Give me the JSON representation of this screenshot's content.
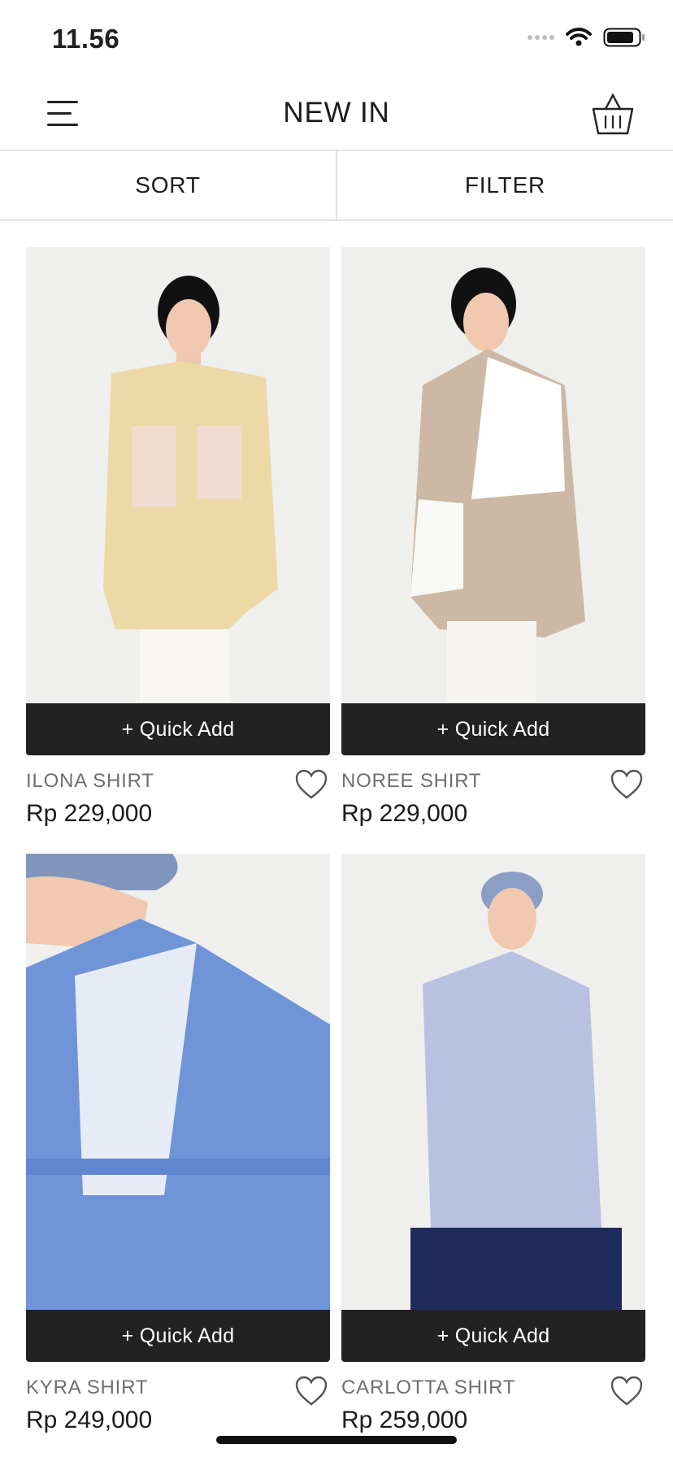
{
  "status": {
    "time": "11.56"
  },
  "header": {
    "title": "NEW IN"
  },
  "toolbar": {
    "sort_label": "SORT",
    "filter_label": "FILTER"
  },
  "products": [
    {
      "name": "ILONA SHIRT",
      "price": "Rp 229,000",
      "quick_add": "+ Quick Add",
      "color": "#ecd9a6"
    },
    {
      "name": "NOREE SHIRT",
      "price": "Rp 229,000",
      "quick_add": "+ Quick Add",
      "color": "#ccb8a4"
    },
    {
      "name": "KYRA SHIRT",
      "price": "Rp 249,000",
      "quick_add": "+ Quick Add",
      "color": "#6f94d8"
    },
    {
      "name": "CARLOTTA SHIRT",
      "price": "Rp 259,000",
      "quick_add": "+ Quick Add",
      "color": "#b8c1df"
    }
  ],
  "icons": [
    "menu-icon",
    "basket-icon",
    "heart-icon",
    "wifi-icon",
    "battery-icon",
    "signal-icon"
  ]
}
